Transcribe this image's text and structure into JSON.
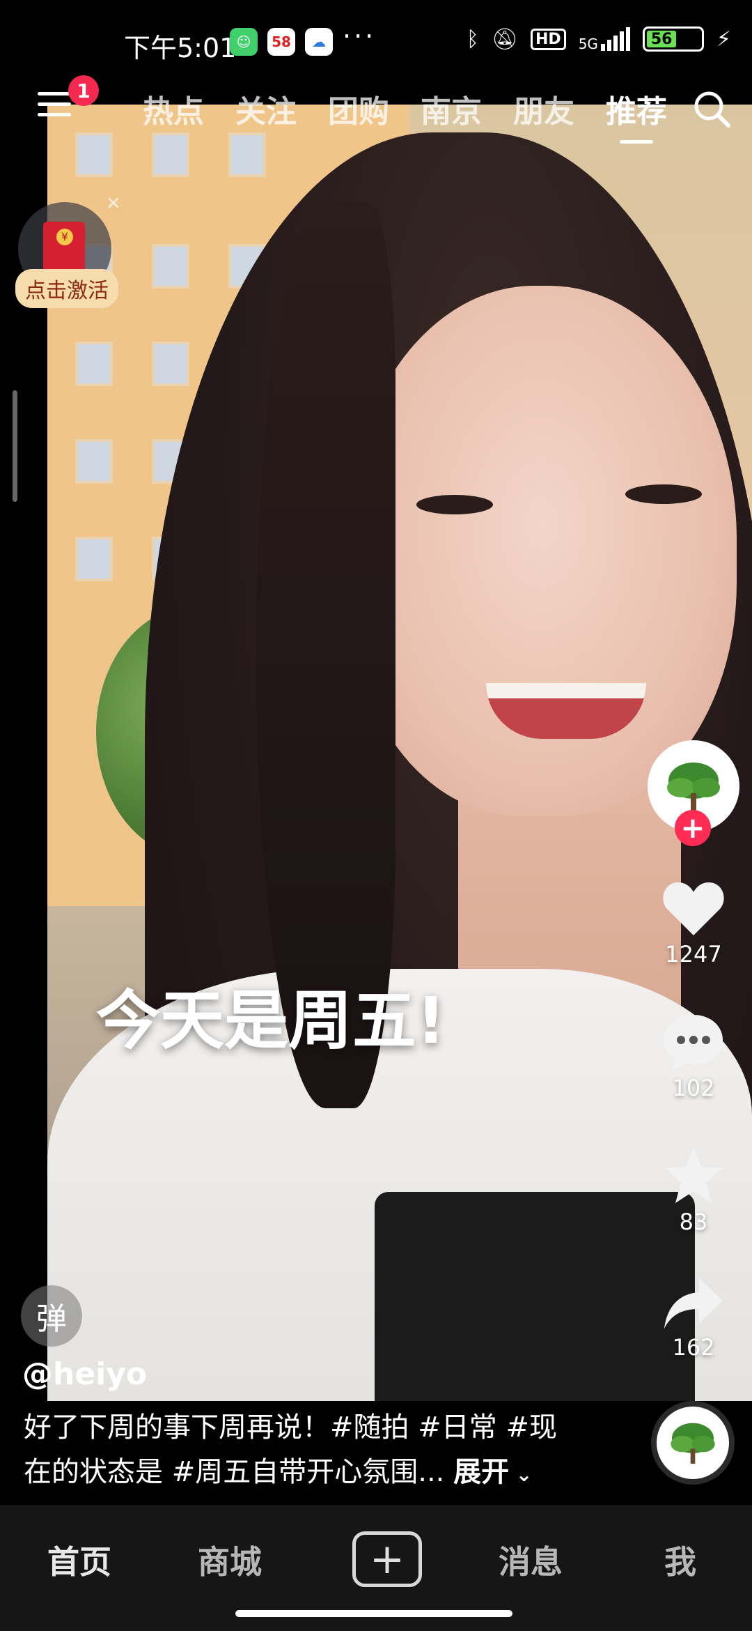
{
  "status_bar": {
    "time": "下午5:01",
    "app_icons": [
      "wechat-style-icon",
      "58-icon",
      "cloud-icon"
    ],
    "overflow": "···",
    "network": "5G",
    "hd_label": "HD",
    "battery_level": "56"
  },
  "top_nav": {
    "notification_count": "1",
    "tabs": [
      "热点",
      "关注",
      "团购",
      "南京",
      "朋友",
      "推荐"
    ],
    "active_tab": "推荐"
  },
  "red_packet": {
    "label": "点击激活",
    "close": "×"
  },
  "video": {
    "overlay_text": "今天是周五!"
  },
  "actions": {
    "likes": "1247",
    "comments": "102",
    "favorites": "83",
    "shares": "162"
  },
  "post": {
    "danmu_label": "弹",
    "author": "@heiyo",
    "description_line1": "好了下周的事下周再说！#随拍 #日常 #现",
    "description_line2": "在的状态是 #周五自带开心氛围...",
    "expand_label": "展开"
  },
  "bottom_nav": {
    "home": "首页",
    "mall": "商城",
    "plus": "+",
    "messages": "消息",
    "me": "我"
  },
  "colors": {
    "accent_red": "#fe2c55",
    "nav_bg": "#161616",
    "battery_green": "#6ae054"
  }
}
